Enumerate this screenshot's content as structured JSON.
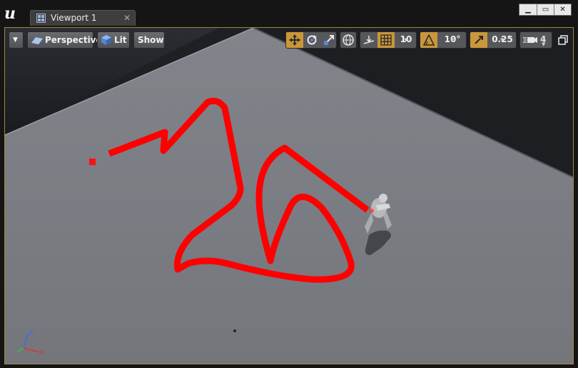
{
  "app": {
    "logo_icon": "unreal-engine-logo",
    "tab_label": "Viewport 1",
    "tab_icon": "viewport-grid-icon",
    "window_controls": [
      "minimize",
      "maximize",
      "close"
    ]
  },
  "toolbar": {
    "perspective_label": "Perspective",
    "lit_label": "Lit",
    "show_label": "Show",
    "grid_snap_value": "10",
    "rotation_snap_value": "10°",
    "scale_snap_value": "0.25",
    "camera_speed_value": "4"
  },
  "colors": {
    "accent_active": "#c9973a",
    "path_red": "#ff0000",
    "floor_gray": "#7b7d84",
    "viewport_border": "#a3843c"
  },
  "gizmo": {
    "z_label": "Z",
    "x_label": "X"
  }
}
